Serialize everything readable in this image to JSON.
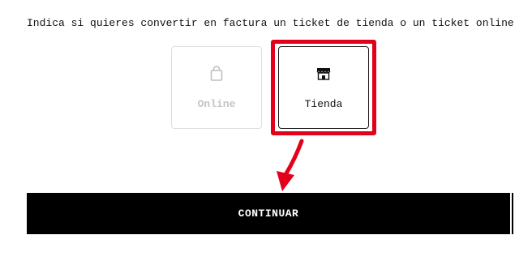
{
  "prompt": {
    "text": "Indica si quieres convertir en factura un ticket de tienda o un ticket online"
  },
  "options": [
    {
      "label": "Online",
      "icon": "shopping-bag-icon",
      "selected": false,
      "color": "#c4c4c4"
    },
    {
      "label": "Tienda",
      "icon": "store-icon",
      "selected": true,
      "color": "#111111"
    }
  ],
  "highlight": {
    "color": "#e3001b"
  },
  "continue_button": {
    "label": "CONTINUAR",
    "background": "#000000",
    "text_color": "#ffffff"
  }
}
